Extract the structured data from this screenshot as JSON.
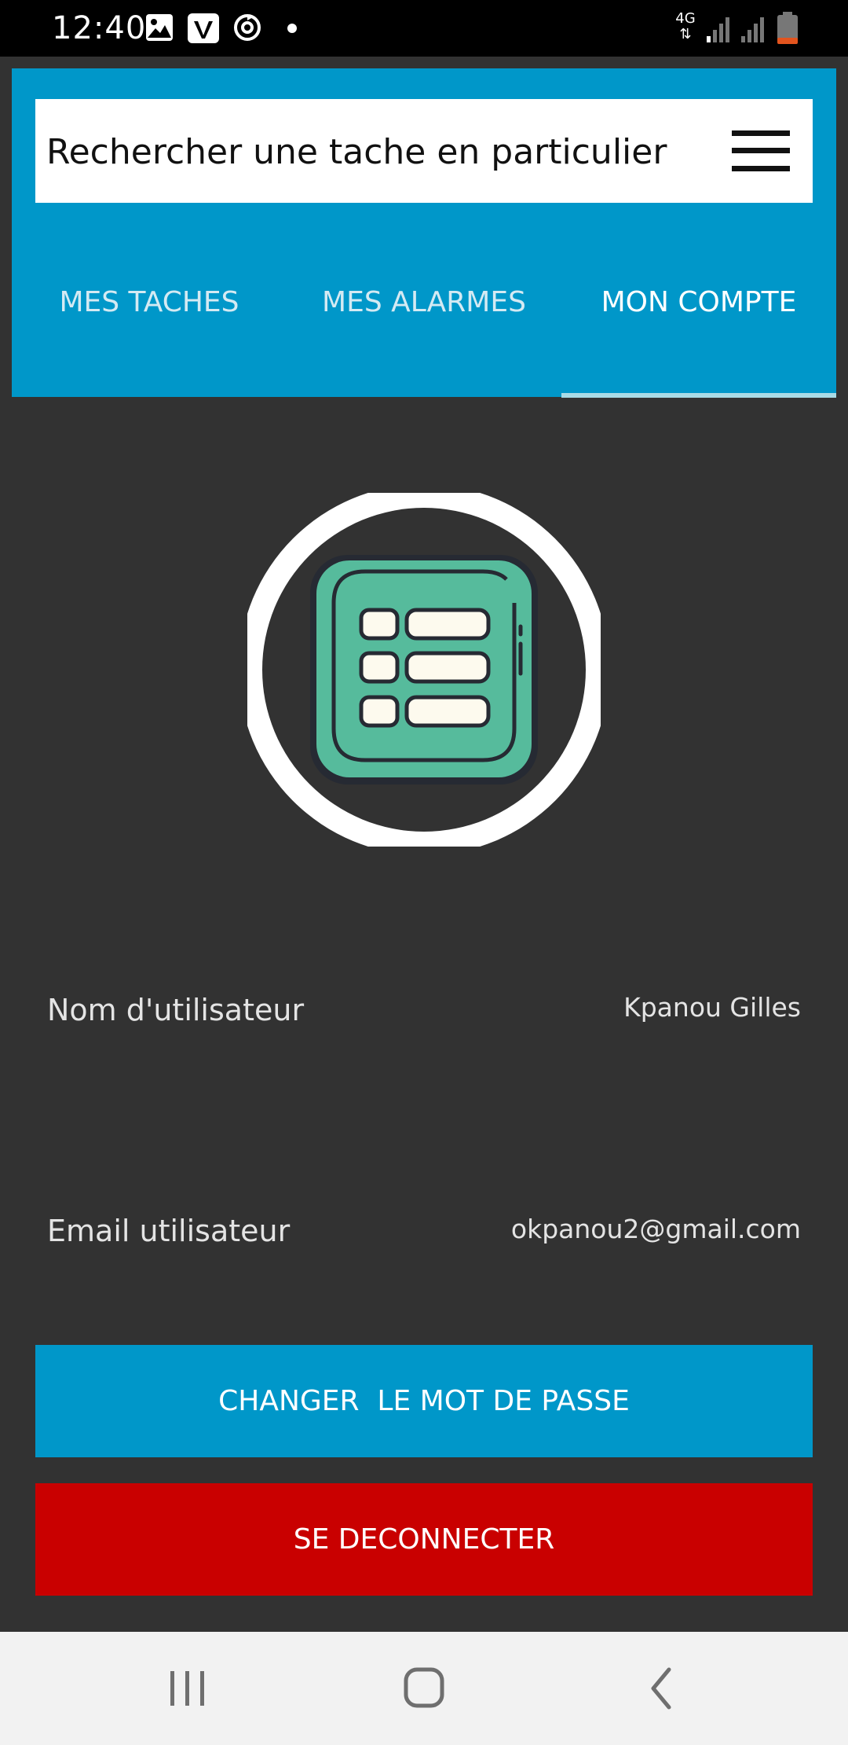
{
  "status_bar": {
    "time": "12:40",
    "network_label": "4G",
    "icons": [
      "gallery-icon",
      "vimeo-icon",
      "sync-icon",
      "notification-dot",
      "network-4g-icon",
      "signal-icon",
      "signal-icon",
      "battery-icon"
    ]
  },
  "header": {
    "search_placeholder": "Rechercher une tache en particulier",
    "menu_icon": "hamburger-menu-icon",
    "tabs": [
      {
        "label": "MES TACHES",
        "active": false
      },
      {
        "label": "MES ALARMES",
        "active": false
      },
      {
        "label": "MON COMPTE",
        "active": true
      }
    ]
  },
  "profile": {
    "avatar_icon": "task-list-icon",
    "fields": [
      {
        "label": "Nom d'utilisateur",
        "value": "Kpanou Gilles"
      },
      {
        "label": "Email utilisateur",
        "value": "okpanou2@gmail.com"
      }
    ]
  },
  "actions": {
    "change_password_label": "CHANGER  LE MOT DE PASSE",
    "logout_label": "SE DECONNECTER"
  },
  "navigation": {
    "icons": [
      "recent-apps-icon",
      "home-icon",
      "back-icon"
    ]
  },
  "colors": {
    "primary": "#0097c9",
    "danger": "#c90000",
    "background": "#323232",
    "tab_indicator": "#a9dbe6",
    "avatar_green": "#56bb9c"
  }
}
